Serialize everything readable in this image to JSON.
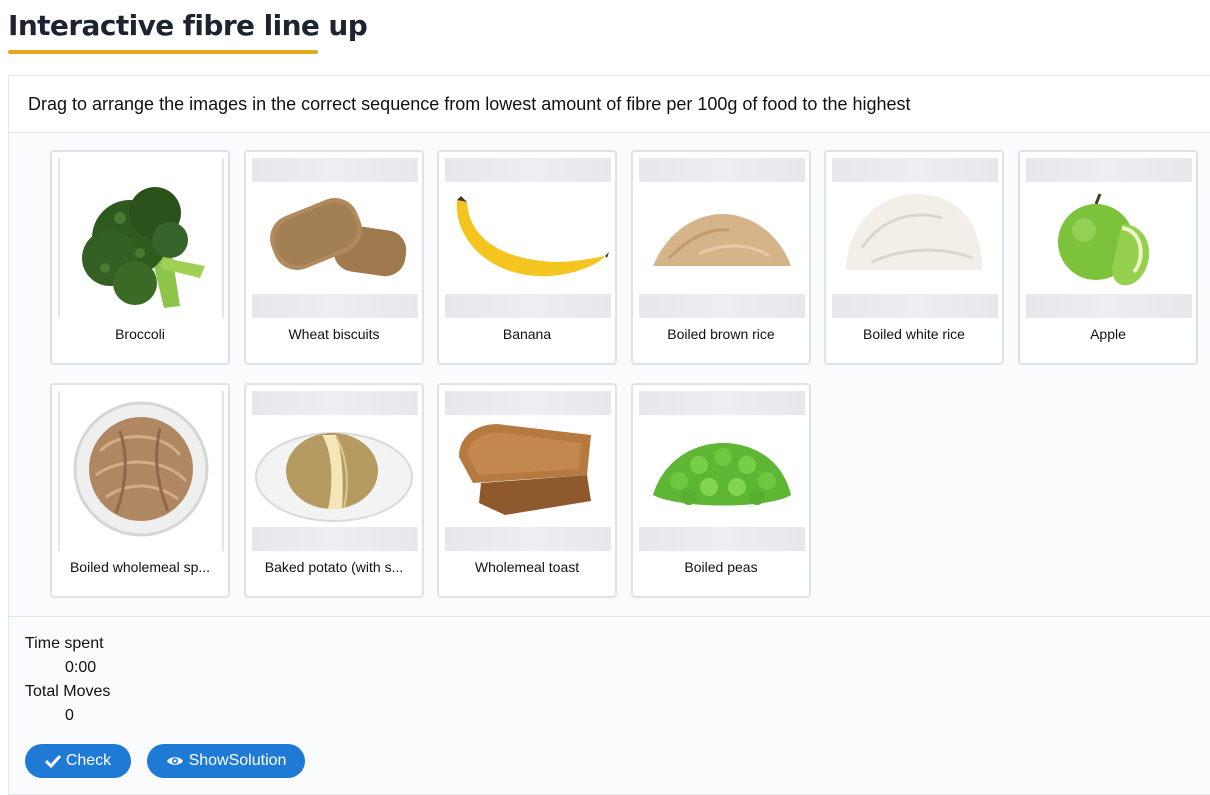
{
  "page": {
    "title": "Interactive fibre line up"
  },
  "activity": {
    "instructions": "Drag to arrange the images in the correct sequence from lowest amount of fibre per 100g of food to the highest"
  },
  "cards": [
    {
      "label": "Broccoli",
      "image": "broccoli"
    },
    {
      "label": "Wheat biscuits",
      "image": "wheat-biscuits"
    },
    {
      "label": "Banana",
      "image": "banana"
    },
    {
      "label": "Boiled brown rice",
      "image": "brown-rice"
    },
    {
      "label": "Boiled white rice",
      "image": "white-rice"
    },
    {
      "label": "Apple",
      "image": "apple"
    },
    {
      "label": "Boiled wholemeal sp...",
      "image": "wholemeal-spaghetti"
    },
    {
      "label": "Baked potato (with s...",
      "image": "baked-potato"
    },
    {
      "label": "Wholemeal toast",
      "image": "wholemeal-toast"
    },
    {
      "label": "Boiled peas",
      "image": "peas"
    }
  ],
  "stats": {
    "time_label": "Time spent",
    "time_value": "0:00",
    "moves_label": "Total Moves",
    "moves_value": "0"
  },
  "buttons": {
    "check_label": "Check",
    "check_icon": "checkmark-icon",
    "solution_label": "ShowSolution",
    "solution_icon": "eye-icon"
  },
  "colors": {
    "accent": "#1f7ad6",
    "title_underline": "#e3a91e"
  }
}
